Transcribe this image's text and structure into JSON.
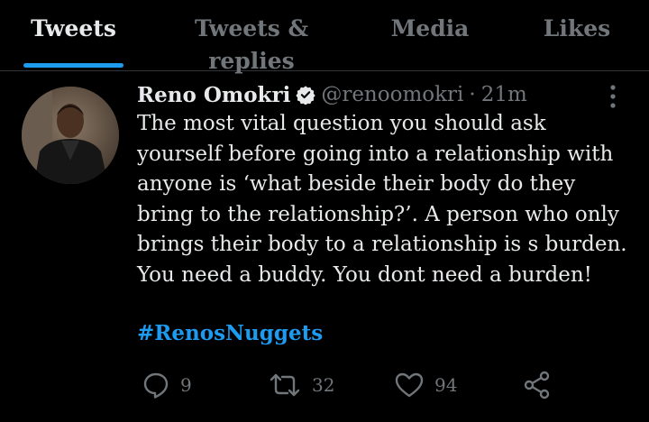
{
  "tabs": [
    {
      "label": "Tweets",
      "active": true
    },
    {
      "label": "Tweets & replies",
      "active": false
    },
    {
      "label": "Media",
      "active": false
    },
    {
      "label": "Likes",
      "active": false
    }
  ],
  "tweet": {
    "author_name": "Reno Omokri",
    "handle": "@renoomokri",
    "separator": "·",
    "time": "21m",
    "verified": true,
    "text": "The most vital question you should ask yourself before going into a relationship with anyone is ‘what beside their body do they bring to the relationship?’. A person who only brings their body to a relationship is s burden. You need a buddy. You dont need a burden!",
    "hashtag": "#RenosNuggets",
    "reply_count": "9",
    "retweet_count": "32",
    "like_count": "94"
  },
  "icons": {
    "verified": "verified-badge-icon",
    "more": "more-vertical-icon",
    "reply": "reply-icon",
    "retweet": "retweet-icon",
    "like": "heart-icon",
    "share": "share-icon"
  },
  "colors": {
    "background": "#000000",
    "text_primary": "#e7e9ea",
    "text_secondary": "#71767b",
    "accent": "#1d9bf0",
    "divider": "#2f3336"
  }
}
